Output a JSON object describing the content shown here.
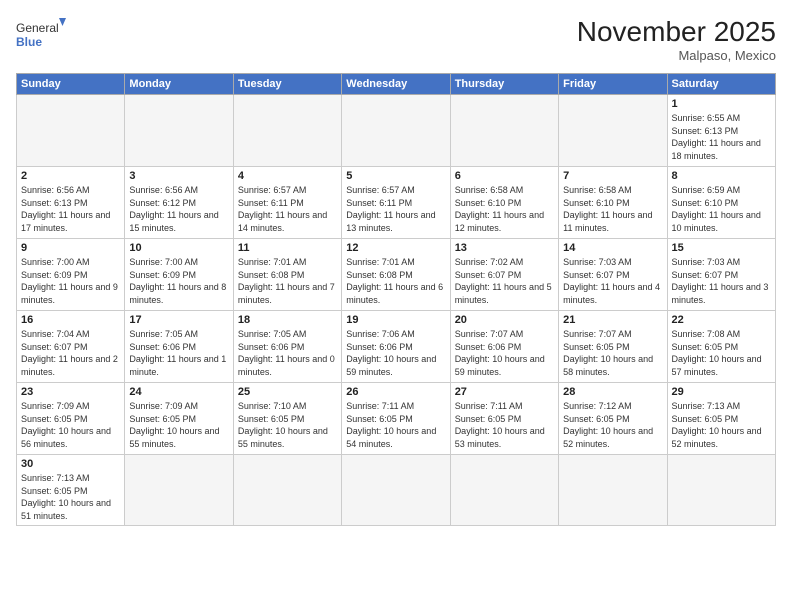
{
  "logo": {
    "general": "General",
    "blue": "Blue"
  },
  "header": {
    "month_year": "November 2025",
    "location": "Malpaso, Mexico"
  },
  "weekdays": [
    "Sunday",
    "Monday",
    "Tuesday",
    "Wednesday",
    "Thursday",
    "Friday",
    "Saturday"
  ],
  "weeks": [
    [
      null,
      null,
      null,
      null,
      null,
      null,
      {
        "day": "1",
        "sunrise": "6:55 AM",
        "sunset": "6:13 PM",
        "daylight": "11 hours and 18 minutes."
      }
    ],
    [
      {
        "day": "2",
        "sunrise": "6:56 AM",
        "sunset": "6:13 PM",
        "daylight": "11 hours and 17 minutes."
      },
      {
        "day": "3",
        "sunrise": "6:56 AM",
        "sunset": "6:12 PM",
        "daylight": "11 hours and 15 minutes."
      },
      {
        "day": "4",
        "sunrise": "6:57 AM",
        "sunset": "6:11 PM",
        "daylight": "11 hours and 14 minutes."
      },
      {
        "day": "5",
        "sunrise": "6:57 AM",
        "sunset": "6:11 PM",
        "daylight": "11 hours and 13 minutes."
      },
      {
        "day": "6",
        "sunrise": "6:58 AM",
        "sunset": "6:10 PM",
        "daylight": "11 hours and 12 minutes."
      },
      {
        "day": "7",
        "sunrise": "6:58 AM",
        "sunset": "6:10 PM",
        "daylight": "11 hours and 11 minutes."
      },
      {
        "day": "8",
        "sunrise": "6:59 AM",
        "sunset": "6:10 PM",
        "daylight": "11 hours and 10 minutes."
      }
    ],
    [
      {
        "day": "9",
        "sunrise": "7:00 AM",
        "sunset": "6:09 PM",
        "daylight": "11 hours and 9 minutes."
      },
      {
        "day": "10",
        "sunrise": "7:00 AM",
        "sunset": "6:09 PM",
        "daylight": "11 hours and 8 minutes."
      },
      {
        "day": "11",
        "sunrise": "7:01 AM",
        "sunset": "6:08 PM",
        "daylight": "11 hours and 7 minutes."
      },
      {
        "day": "12",
        "sunrise": "7:01 AM",
        "sunset": "6:08 PM",
        "daylight": "11 hours and 6 minutes."
      },
      {
        "day": "13",
        "sunrise": "7:02 AM",
        "sunset": "6:07 PM",
        "daylight": "11 hours and 5 minutes."
      },
      {
        "day": "14",
        "sunrise": "7:03 AM",
        "sunset": "6:07 PM",
        "daylight": "11 hours and 4 minutes."
      },
      {
        "day": "15",
        "sunrise": "7:03 AM",
        "sunset": "6:07 PM",
        "daylight": "11 hours and 3 minutes."
      }
    ],
    [
      {
        "day": "16",
        "sunrise": "7:04 AM",
        "sunset": "6:07 PM",
        "daylight": "11 hours and 2 minutes."
      },
      {
        "day": "17",
        "sunrise": "7:05 AM",
        "sunset": "6:06 PM",
        "daylight": "11 hours and 1 minute."
      },
      {
        "day": "18",
        "sunrise": "7:05 AM",
        "sunset": "6:06 PM",
        "daylight": "11 hours and 0 minutes."
      },
      {
        "day": "19",
        "sunrise": "7:06 AM",
        "sunset": "6:06 PM",
        "daylight": "10 hours and 59 minutes."
      },
      {
        "day": "20",
        "sunrise": "7:07 AM",
        "sunset": "6:06 PM",
        "daylight": "10 hours and 59 minutes."
      },
      {
        "day": "21",
        "sunrise": "7:07 AM",
        "sunset": "6:05 PM",
        "daylight": "10 hours and 58 minutes."
      },
      {
        "day": "22",
        "sunrise": "7:08 AM",
        "sunset": "6:05 PM",
        "daylight": "10 hours and 57 minutes."
      }
    ],
    [
      {
        "day": "23",
        "sunrise": "7:09 AM",
        "sunset": "6:05 PM",
        "daylight": "10 hours and 56 minutes."
      },
      {
        "day": "24",
        "sunrise": "7:09 AM",
        "sunset": "6:05 PM",
        "daylight": "10 hours and 55 minutes."
      },
      {
        "day": "25",
        "sunrise": "7:10 AM",
        "sunset": "6:05 PM",
        "daylight": "10 hours and 55 minutes."
      },
      {
        "day": "26",
        "sunrise": "7:11 AM",
        "sunset": "6:05 PM",
        "daylight": "10 hours and 54 minutes."
      },
      {
        "day": "27",
        "sunrise": "7:11 AM",
        "sunset": "6:05 PM",
        "daylight": "10 hours and 53 minutes."
      },
      {
        "day": "28",
        "sunrise": "7:12 AM",
        "sunset": "6:05 PM",
        "daylight": "10 hours and 52 minutes."
      },
      {
        "day": "29",
        "sunrise": "7:13 AM",
        "sunset": "6:05 PM",
        "daylight": "10 hours and 52 minutes."
      }
    ],
    [
      {
        "day": "30",
        "sunrise": "7:13 AM",
        "sunset": "6:05 PM",
        "daylight": "10 hours and 51 minutes."
      },
      null,
      null,
      null,
      null,
      null,
      null
    ]
  ]
}
